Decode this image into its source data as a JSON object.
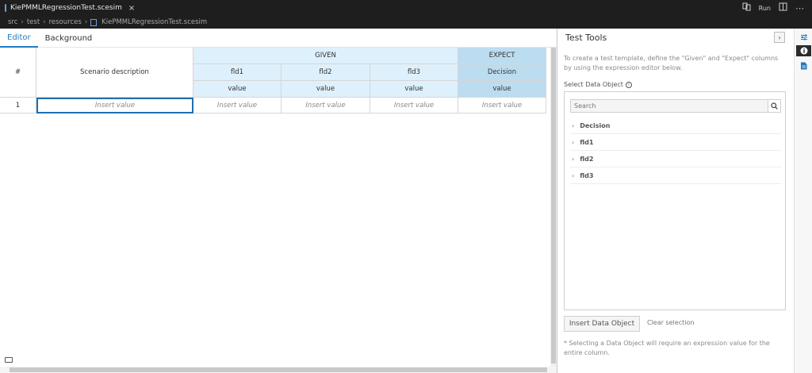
{
  "window": {
    "tab_title": "KiePMMLRegressionTest.scesim",
    "close_glyph": "×",
    "run_label": "Run"
  },
  "breadcrumb": {
    "items": [
      "src",
      "test",
      "resources",
      "KiePMMLRegressionTest.scesim"
    ]
  },
  "editor": {
    "tabs": [
      {
        "label": "Editor",
        "active": true
      },
      {
        "label": "Background",
        "active": false
      }
    ]
  },
  "grid": {
    "index_header": "#",
    "description_header": "Scenario description",
    "given_header": "GIVEN",
    "expect_header": "EXPECT",
    "columns": [
      {
        "name": "fld1",
        "sub": "value"
      },
      {
        "name": "fld2",
        "sub": "value"
      },
      {
        "name": "fld3",
        "sub": "value"
      },
      {
        "name": "Decision",
        "sub": "value"
      }
    ],
    "rows": [
      {
        "index": "1",
        "description": "Insert value",
        "values": [
          "Insert value",
          "Insert value",
          "Insert value",
          "Insert value"
        ]
      }
    ]
  },
  "test_tools": {
    "title": "Test Tools",
    "collapse_glyph": "›",
    "description": "To create a test template, define the \"Given\" and \"Expect\" columns by using the expression editor below.",
    "select_label": "Select Data Object",
    "search_placeholder": "Search",
    "tree_items": [
      "Decision",
      "fld1",
      "fld2",
      "fld3"
    ],
    "insert_button": "Insert Data Object",
    "clear_button": "Clear selection",
    "footnote": "* Selecting a Data Object will require an expression value for the entire column."
  },
  "colors": {
    "accent": "#1f7bc1",
    "given_bg": "#def0fb",
    "expect_bg": "#bcdcef",
    "dark_bar": "#1e1e1e"
  }
}
